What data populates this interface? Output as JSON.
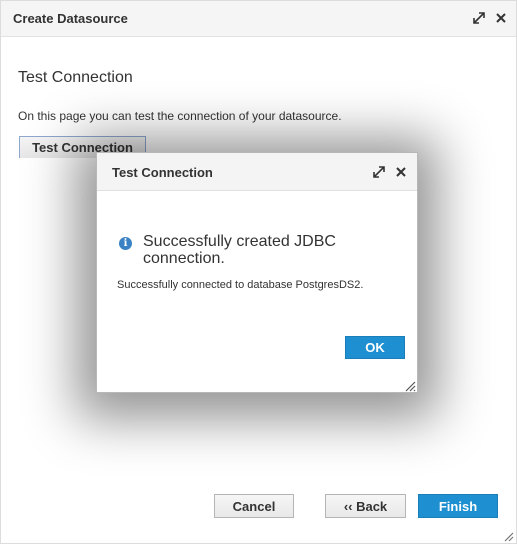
{
  "window": {
    "title": "Create Datasource",
    "icons": [
      "expand-icon",
      "close-icon"
    ]
  },
  "page": {
    "heading": "Test Connection",
    "description": "On this page you can test the connection of your datasource.",
    "test_button_label": "Test Connection"
  },
  "dialog": {
    "title": "Test Connection",
    "icons": [
      "expand-icon",
      "close-icon",
      "info-icon",
      "resize-grip-icon"
    ],
    "message": "Successfully created JDBC connection.",
    "detail": "Successfully connected to database PostgresDS2.",
    "ok_label": "OK"
  },
  "footer": {
    "cancel_label": "Cancel",
    "back_label": "‹‹ Back",
    "finish_label": "Finish"
  },
  "colors": {
    "primary_button": "#1e8fd0",
    "info_icon": "#3b82c4"
  }
}
